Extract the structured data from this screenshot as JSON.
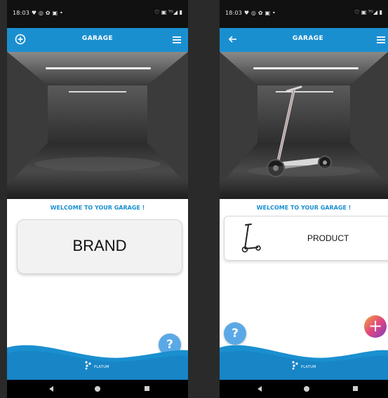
{
  "status_bar": {
    "time": "18:03",
    "left_icons": "♥ ◎ ✿ ▣ •",
    "right_icons": "♡ ▣ ᵀᴳ◢ ▮"
  },
  "left_screen": {
    "app_bar": {
      "title": "GARAGE",
      "left_icon": "add-circle-icon",
      "right_icon": "hamburger-menu-icon"
    },
    "welcome": "WELCOME TO YOUR GARAGE !",
    "card": {
      "label": "BRAND"
    },
    "help_fab": {
      "label": "?"
    },
    "footer": {
      "logo_text": "PLATUM"
    }
  },
  "right_screen": {
    "app_bar": {
      "title": "GARAGE",
      "left_icon": "back-arrow-icon",
      "right_icon": "hamburger-menu-icon"
    },
    "welcome": "WELCOME TO YOUR GARAGE !",
    "card": {
      "label": "PRODUCT",
      "thumbnail": "scooter-thumbnail"
    },
    "help_fab": {
      "label": "?"
    },
    "add_fab": {
      "label": "+"
    },
    "footer": {
      "logo_text": "PLATUM"
    }
  },
  "colors": {
    "app_bar": "#1a8fd0",
    "accent_blue": "#1a8fd0",
    "help_fab": "#5aa9e6",
    "status_bar": "#111111",
    "nav_bar": "#000000"
  }
}
